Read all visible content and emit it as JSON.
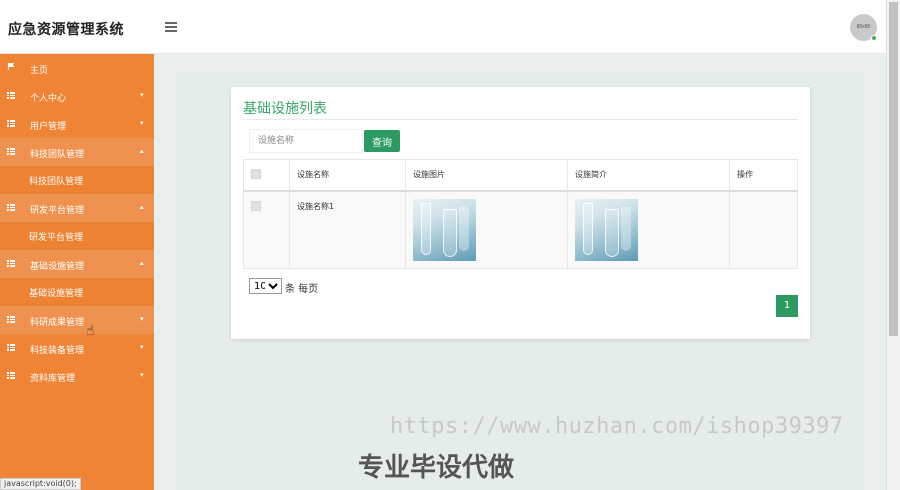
{
  "header": {
    "app_title": "应急资源管理系统",
    "avatar_text": "80x80"
  },
  "sidebar": {
    "items": [
      {
        "label": "主页",
        "icon": "flag-icon",
        "expanded": false,
        "children": []
      },
      {
        "label": "个人中心",
        "icon": "grid-icon",
        "expanded": false,
        "children": []
      },
      {
        "label": "用户管理",
        "icon": "grid-icon",
        "expanded": false,
        "children": []
      },
      {
        "label": "科技团队管理",
        "icon": "grid-icon",
        "expanded": true,
        "children": [
          "科技团队管理"
        ]
      },
      {
        "label": "研发平台管理",
        "icon": "grid-icon",
        "expanded": true,
        "children": [
          "研发平台管理"
        ]
      },
      {
        "label": "基础设施管理",
        "icon": "grid-icon",
        "expanded": true,
        "children": [
          "基础设施管理"
        ]
      },
      {
        "label": "科研成果管理",
        "icon": "grid-icon",
        "expanded": false,
        "children": []
      },
      {
        "label": "科技装备管理",
        "icon": "grid-icon",
        "expanded": false,
        "children": []
      },
      {
        "label": "资料库管理",
        "icon": "grid-icon",
        "expanded": false,
        "children": []
      }
    ]
  },
  "main": {
    "card_title": "基础设施列表",
    "search": {
      "placeholder": "设施名称",
      "value": "",
      "button_label": "查询"
    },
    "table": {
      "columns": [
        "",
        "设施名称",
        "设施图片",
        "设施简介",
        "操作"
      ],
      "rows": [
        {
          "name": "设施名称1",
          "image": "lab-glassware-photo",
          "intro_image": "lab-glassware-photo",
          "actions": ""
        }
      ]
    },
    "pagination": {
      "page_size": "10",
      "per_page_label": "条 每页",
      "current_page": "1",
      "page_size_options": [
        "10"
      ]
    }
  },
  "watermark": {
    "url": "https://www.huzhan.com/ishop39397",
    "text": "专业毕设代做"
  },
  "status_bar": "javascript:void(0);",
  "colors": {
    "sidebar": "#ef8437",
    "accent_green": "#2d9a61",
    "title_green": "#3aa66a"
  }
}
